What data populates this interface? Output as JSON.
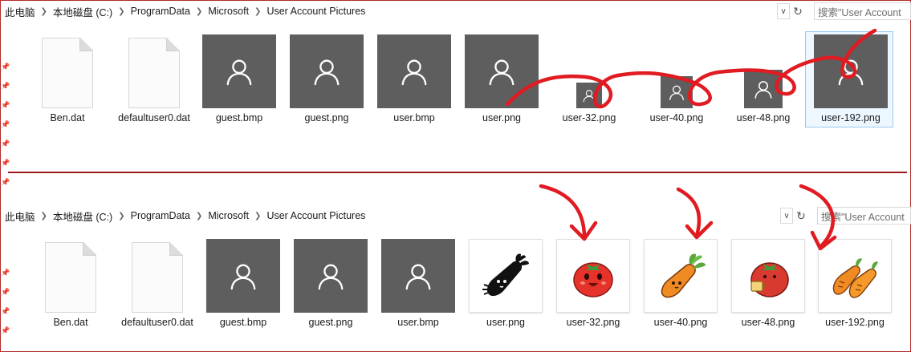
{
  "colors": {
    "annotation_red": "#e01b22",
    "thumb_gray": "#5e5e5e",
    "divider": "#a01a1a"
  },
  "top": {
    "breadcrumb": [
      "此电脑",
      "本地磁盘 (C:)",
      "ProgramData",
      "Microsoft",
      "User Account Pictures"
    ],
    "search_placeholder": "搜索\"User Account",
    "files": [
      {
        "name": "Ben.dat",
        "icon": "document-icon"
      },
      {
        "name": "defaultuser0.dat",
        "icon": "document-icon"
      },
      {
        "name": "guest.bmp",
        "icon": "user-icon"
      },
      {
        "name": "guest.png",
        "icon": "user-icon"
      },
      {
        "name": "user.bmp",
        "icon": "user-icon"
      },
      {
        "name": "user.png",
        "icon": "user-icon"
      },
      {
        "name": "user-32.png",
        "icon": "user-icon"
      },
      {
        "name": "user-40.png",
        "icon": "user-icon"
      },
      {
        "name": "user-48.png",
        "icon": "user-icon"
      },
      {
        "name": "user-192.png",
        "icon": "user-icon"
      }
    ]
  },
  "bottom": {
    "breadcrumb": [
      "此电脑",
      "本地磁盘 (C:)",
      "ProgramData",
      "Microsoft",
      "User Account Pictures"
    ],
    "search_placeholder": "搜索\"User Account",
    "files": [
      {
        "name": "Ben.dat",
        "icon": "document-icon"
      },
      {
        "name": "defaultuser0.dat",
        "icon": "document-icon"
      },
      {
        "name": "guest.bmp",
        "icon": "user-icon"
      },
      {
        "name": "guest.png",
        "icon": "user-icon"
      },
      {
        "name": "user.bmp",
        "icon": "user-icon"
      },
      {
        "name": "user.png",
        "icon": "carrot-black-icon"
      },
      {
        "name": "user-32.png",
        "icon": "tomato-icon"
      },
      {
        "name": "user-40.png",
        "icon": "carrot-icon"
      },
      {
        "name": "user-48.png",
        "icon": "tomato-cup-icon"
      },
      {
        "name": "user-192.png",
        "icon": "two-carrots-icon"
      }
    ]
  }
}
